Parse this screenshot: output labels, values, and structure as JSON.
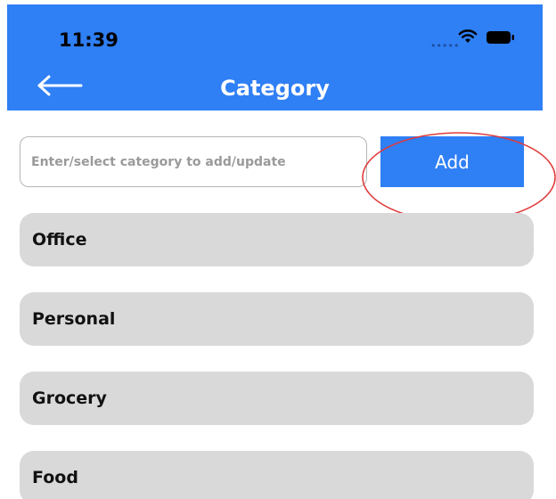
{
  "status_bar": {
    "time": "11:39",
    "icons": [
      "cellular-dots-icon",
      "wifi-icon",
      "battery-icon"
    ]
  },
  "header": {
    "back_icon": "arrow-left-icon",
    "title": "Category",
    "background_color": "#2f7ff5"
  },
  "form": {
    "input_placeholder": "Enter/select category to add/update",
    "input_value": "",
    "add_label": "Add"
  },
  "categories": [
    {
      "label": "Office"
    },
    {
      "label": "Personal"
    },
    {
      "label": "Grocery"
    },
    {
      "label": "Food"
    }
  ],
  "colors": {
    "accent": "#2f7ff5",
    "item_background": "#d9d9d9",
    "annotation": "#e03a3a"
  }
}
